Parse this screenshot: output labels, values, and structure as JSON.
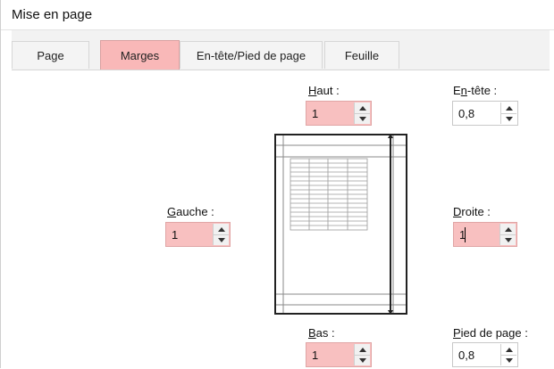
{
  "dialog": {
    "title": "Mise en page",
    "tabs": [
      {
        "label": "Page",
        "active": false
      },
      {
        "label": "Marges",
        "active": true
      },
      {
        "label": "En-tête/Pied de page",
        "active": false
      },
      {
        "label": "Feuille",
        "active": false
      }
    ]
  },
  "margins": {
    "top": {
      "label_ul": "H",
      "label_rest": "aut :",
      "value": "1"
    },
    "header": {
      "label_pre": "E",
      "label_ul": "n",
      "label_rest": "-tête :",
      "value": "0,8"
    },
    "left": {
      "label_ul": "G",
      "label_rest": "auche :",
      "value": "1"
    },
    "right": {
      "label_ul": "D",
      "label_rest": "roite :",
      "value": "1"
    },
    "bottom": {
      "label_ul": "B",
      "label_rest": "as :",
      "value": "1"
    },
    "footer": {
      "label_ul": "P",
      "label_rest": "ied de page :",
      "value": "0,8"
    }
  },
  "colors": {
    "active_tab": "#f9b8b8",
    "highlight_field": "#f8c0c0"
  }
}
